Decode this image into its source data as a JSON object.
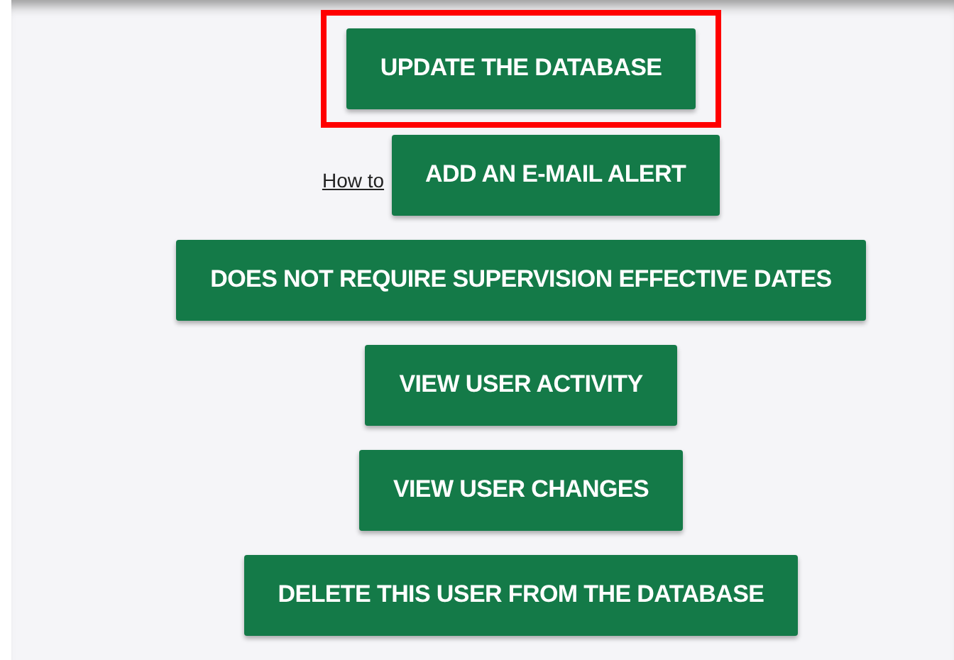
{
  "actions": [
    {
      "label": "UPDATE THE DATABASE",
      "highlighted": true
    },
    {
      "label": "ADD AN E-MAIL ALERT",
      "highlighted": false,
      "help_link": "How to"
    },
    {
      "label": "DOES NOT REQUIRE SUPERVISION EFFECTIVE DATES",
      "highlighted": false
    },
    {
      "label": "VIEW USER ACTIVITY",
      "highlighted": false
    },
    {
      "label": "VIEW USER CHANGES",
      "highlighted": false
    },
    {
      "label": "DELETE THIS USER FROM THE DATABASE",
      "highlighted": false
    }
  ]
}
